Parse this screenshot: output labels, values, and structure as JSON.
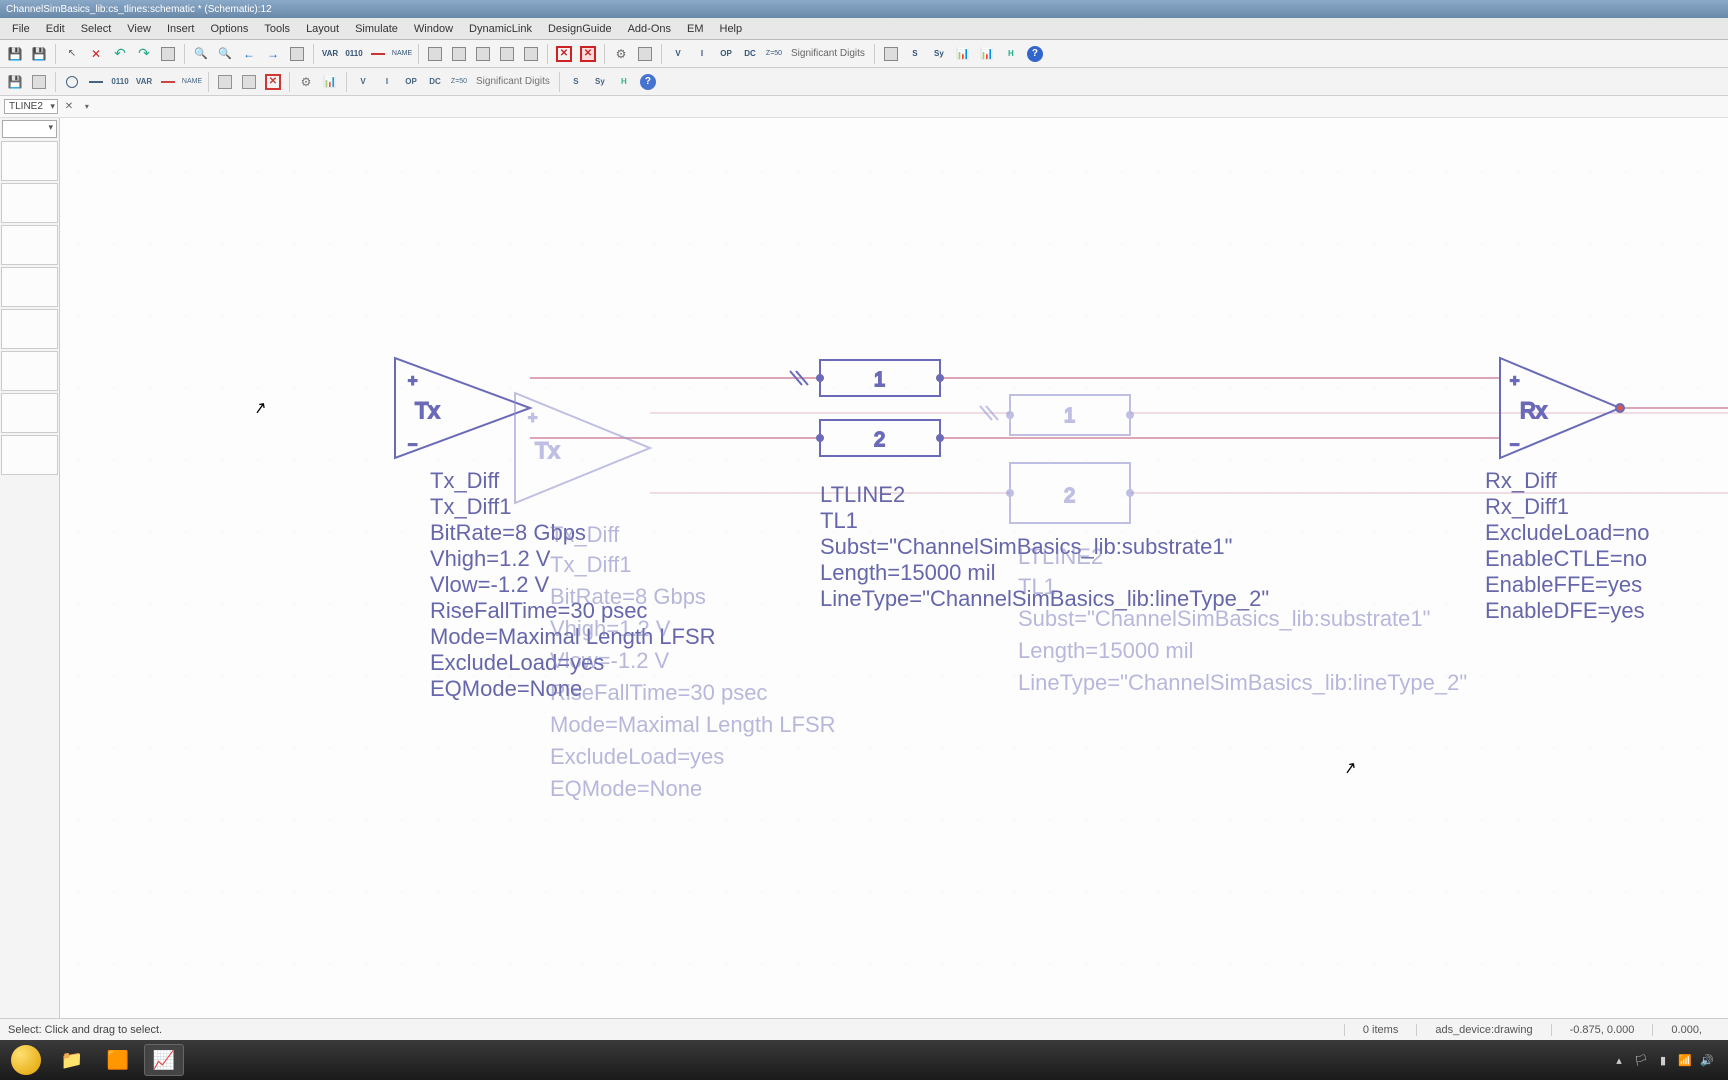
{
  "window": {
    "title": "ChannelSimBasics_lib:cs_tlines:schematic * (Schematic):12"
  },
  "menu": {
    "items": [
      "File",
      "Edit",
      "Select",
      "View",
      "Insert",
      "Options",
      "Tools",
      "Layout",
      "Simulate",
      "Window",
      "DynamicLink",
      "DesignGuide",
      "Add-Ons",
      "EM",
      "Help"
    ]
  },
  "toolbar_labels": {
    "var": "VAR",
    "name": "NAME",
    "z50": "Z=50",
    "significant_digits": "Significant Digits",
    "dc": "DC",
    "op": "OP",
    "v": "V",
    "i": "I",
    "s": "S",
    "sy": "Sy",
    "h": "H",
    "bin": "0110"
  },
  "combo": {
    "value": "TLINE2"
  },
  "statusbar": {
    "hint": "Select: Click and drag to select.",
    "items_count": "0 items",
    "layer": "ads_device:drawing",
    "coord1": "-0.875, 0.000",
    "coord2": "0.000,"
  },
  "schematic": {
    "tx": {
      "label": "Tx",
      "name": "Tx_Diff",
      "inst": "Tx_Diff1",
      "params": [
        "BitRate=8 Gbps",
        "Vhigh=1.2 V",
        "Vlow=-1.2 V",
        "RiseFallTime=30 psec",
        "Mode=Maximal Length LFSR",
        "ExcludeLoad=yes",
        "EQMode=None"
      ]
    },
    "tline": {
      "name": "LTLINE2",
      "inst": "TL1",
      "port1": "1",
      "port2": "2",
      "params": [
        "Subst=\"ChannelSimBasics_lib:substrate1\"",
        "Length=15000 mil",
        "LineType=\"ChannelSimBasics_lib:lineType_2\""
      ]
    },
    "tline_ghost": {
      "name": "LTLINE2",
      "inst": "TL1",
      "port1": "1",
      "port2": "2",
      "params": [
        "Subst=\"ChannelSimBasics_lib:substrate1\"",
        "Length=15000 mil",
        "LineType=\"ChannelSimBasics_lib:lineType_2\""
      ]
    },
    "rx": {
      "label": "Rx",
      "name": "Rx_Diff",
      "inst": "Rx_Diff1",
      "params": [
        "ExcludeLoad=no",
        "EnableCTLE=no",
        "EnableFFE=yes",
        "EnableDFE=yes"
      ]
    }
  }
}
